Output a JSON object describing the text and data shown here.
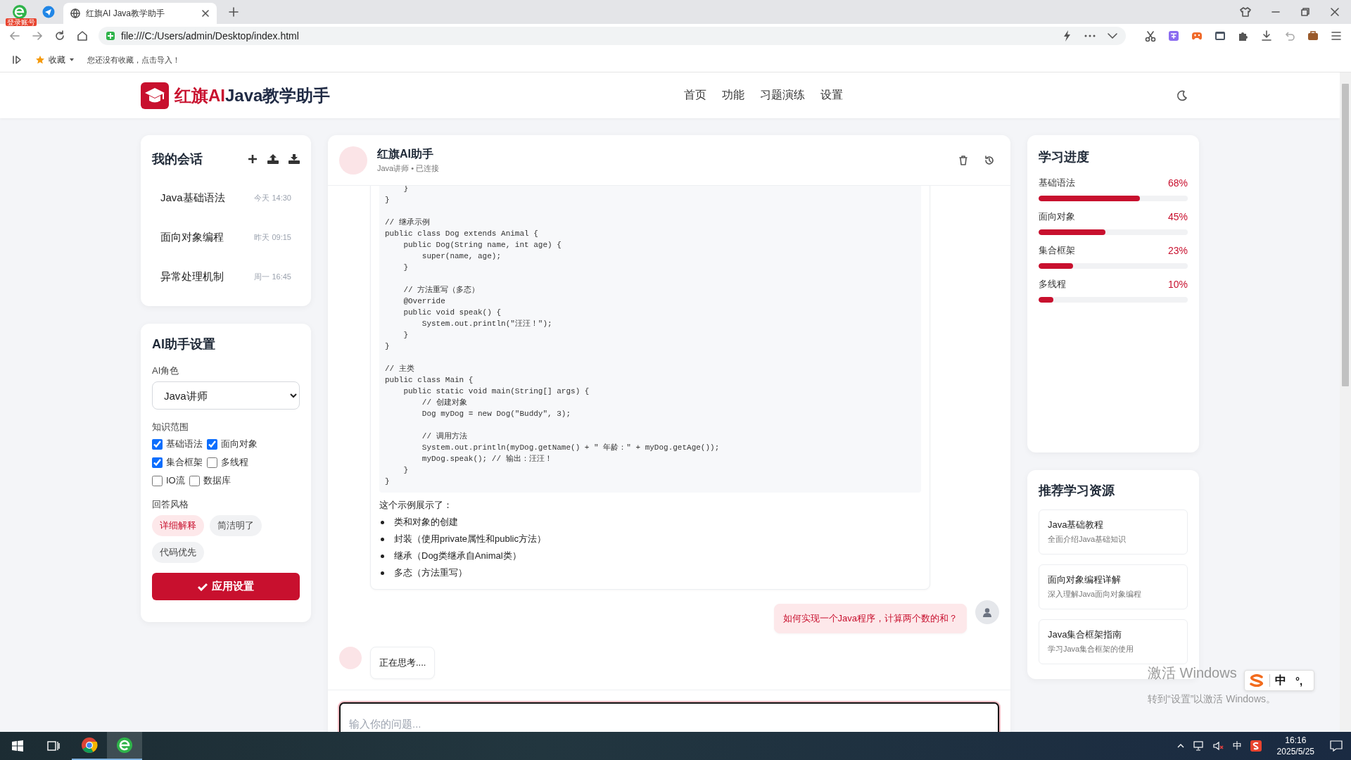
{
  "browser": {
    "login_badge": "登录账号",
    "tab_title": "红旗AI Java教学助手",
    "url": "file:///C:/Users/admin/Desktop/index.html",
    "bookmarks_label": "收藏",
    "bookmarks_hint": "您还没有收藏，点击导入！"
  },
  "header": {
    "logo_accent": "红旗AI",
    "logo_rest": "Java教学助手",
    "nav": [
      {
        "label": "首页"
      },
      {
        "label": "功能"
      },
      {
        "label": "习题演练"
      },
      {
        "label": "设置"
      }
    ]
  },
  "conversations": {
    "title": "我的会话",
    "items": [
      {
        "title": "Java基础语法",
        "time": "今天 14:30"
      },
      {
        "title": "面向对象编程",
        "time": "昨天 09:15"
      },
      {
        "title": "异常处理机制",
        "time": "周一 16:45"
      }
    ]
  },
  "settings": {
    "title": "AI助手设置",
    "role_label": "AI角色",
    "role_value": "Java讲师",
    "scope_label": "知识范围",
    "scope": [
      {
        "label": "基础语法",
        "checked": true
      },
      {
        "label": "面向对象",
        "checked": true
      },
      {
        "label": "集合框架",
        "checked": true
      },
      {
        "label": "多线程",
        "checked": false
      },
      {
        "label": "IO流",
        "checked": false
      },
      {
        "label": "数据库",
        "checked": false
      }
    ],
    "style_label": "回答风格",
    "styles": [
      {
        "label": "详细解释",
        "selected": true
      },
      {
        "label": "简洁明了",
        "selected": false
      },
      {
        "label": "代码优先",
        "selected": false
      }
    ],
    "apply": "应用设置"
  },
  "chat": {
    "name": "红旗AI助手",
    "status": "Java讲师 • 已连接",
    "messages": [
      {
        "kind": "bot",
        "avatar": false,
        "code": "    }\n}\n\n// 继承示例\npublic class Dog extends Animal {\n    public Dog(String name, int age) {\n        super(name, age);\n    }\n\n    // 方法重写（多态）\n    @Override\n    public void speak() {\n        System.out.println(\"汪汪！\");\n    }\n}\n\n// 主类\npublic class Main {\n    public static void main(String[] args) {\n        // 创建对象\n        Dog myDog = new Dog(\"Buddy\", 3);\n\n        // 调用方法\n        System.out.println(myDog.getName() + \" 年龄：\" + myDog.getAge());\n        myDog.speak(); // 输出：汪汪！\n    }\n}",
        "summary": "这个示例展示了：",
        "bullets": [
          "类和对象的创建",
          "封装（使用private属性和public方法）",
          "继承（Dog类继承自Animal类）",
          "多态（方法重写）"
        ]
      },
      {
        "kind": "user",
        "text": "如何实现一个Java程序，计算两个数的和？"
      },
      {
        "kind": "bot",
        "avatar": true,
        "text": "正在思考...."
      }
    ],
    "input_placeholder": "输入你的问题..."
  },
  "progress": {
    "title": "学习进度",
    "items": [
      {
        "label": "基础语法",
        "value": "68%",
        "level": 0.68
      },
      {
        "label": "面向对象",
        "value": "45%",
        "level": 0.45
      },
      {
        "label": "集合框架",
        "value": "23%",
        "level": 0.23
      },
      {
        "label": "多线程",
        "value": "10%",
        "level": 0.1
      }
    ]
  },
  "resources": {
    "title": "推荐学习资源",
    "items": [
      {
        "title": "Java基础教程",
        "desc": "全面介绍Java基础知识"
      },
      {
        "title": "面向对象编程详解",
        "desc": "深入理解Java面向对象编程"
      },
      {
        "title": "Java集合框架指南",
        "desc": "学习Java集合框架的使用"
      }
    ]
  },
  "system": {
    "activate_title": "激活 Windows",
    "activate_hint": "转到“设置”以激活 Windows。",
    "ime_mode": "中",
    "ime_punct": "°,",
    "tray_lang": "中",
    "time": "16:16",
    "date": "2025/5/25"
  }
}
